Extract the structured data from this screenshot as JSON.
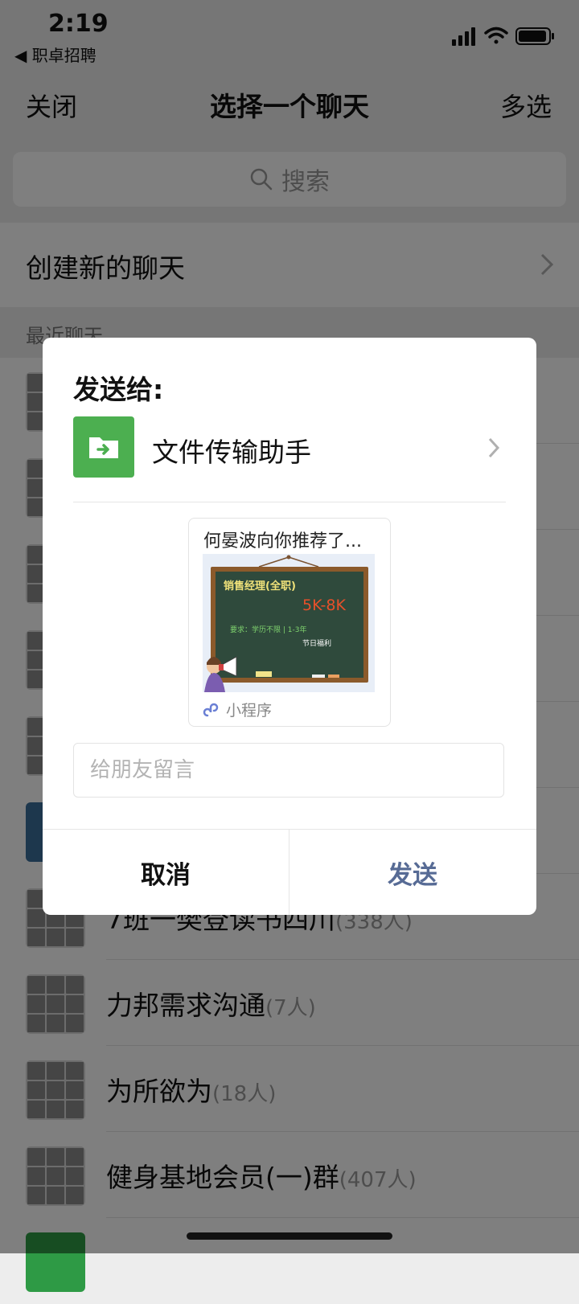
{
  "status": {
    "time": "2:19",
    "back_app": "◀ 职卓招聘"
  },
  "nav": {
    "close_label": "关闭",
    "title": "选择一个聊天",
    "multi_select_label": "多选"
  },
  "search": {
    "placeholder": "搜索"
  },
  "new_chat_label": "创建新的聊天",
  "recent_header": "最近聊天",
  "chat_list": [
    {
      "name": "7班一樊登读书四川",
      "count": "(338人)"
    },
    {
      "name": "力邦需求沟通",
      "count": "(7人)"
    },
    {
      "name": "为所欲为",
      "count": "(18人)"
    },
    {
      "name": "健身基地会员(一)群",
      "count": "(407人)"
    }
  ],
  "dialog": {
    "send_to_label": "发送给:",
    "recipient_name": "文件传输助手",
    "card": {
      "title": "何晏波向你推荐了...",
      "job_title": "销售经理(全职)",
      "salary": "5K-8K",
      "requirements": "要求：学历不限 | 1-3年",
      "benefit": "节日福利",
      "mini_program_label": "小程序"
    },
    "message_placeholder": "给朋友留言",
    "cancel_label": "取消",
    "send_label": "发送"
  },
  "colors": {
    "accent_green": "#4caf50",
    "send_blue": "#576b95",
    "salary_red": "#e8502a"
  }
}
